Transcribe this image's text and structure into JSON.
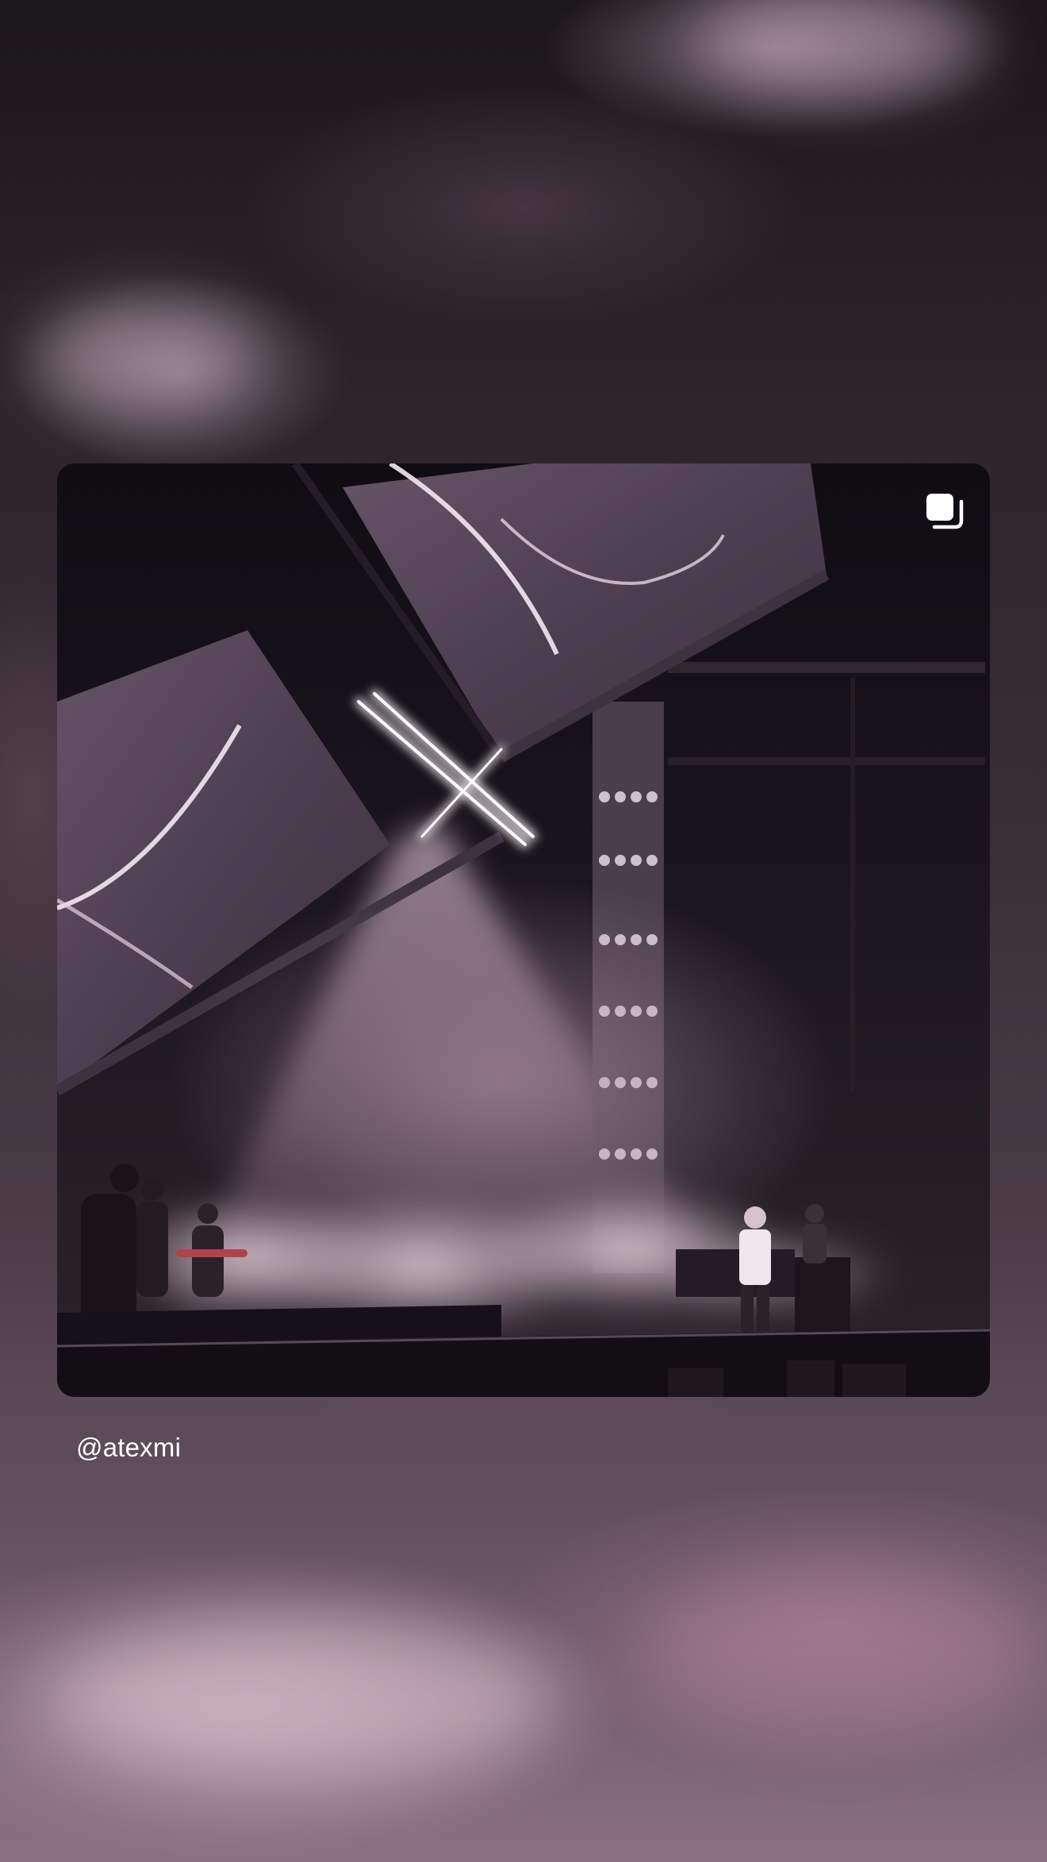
{
  "story": {
    "username": "@atexmi",
    "icon": "multiple-posts-icon"
  },
  "colors": {
    "backdrop_top": "#1c171c",
    "backdrop_bottom": "#8a7080",
    "stage_light": "#d8b8d0",
    "text": "#ffffff"
  }
}
